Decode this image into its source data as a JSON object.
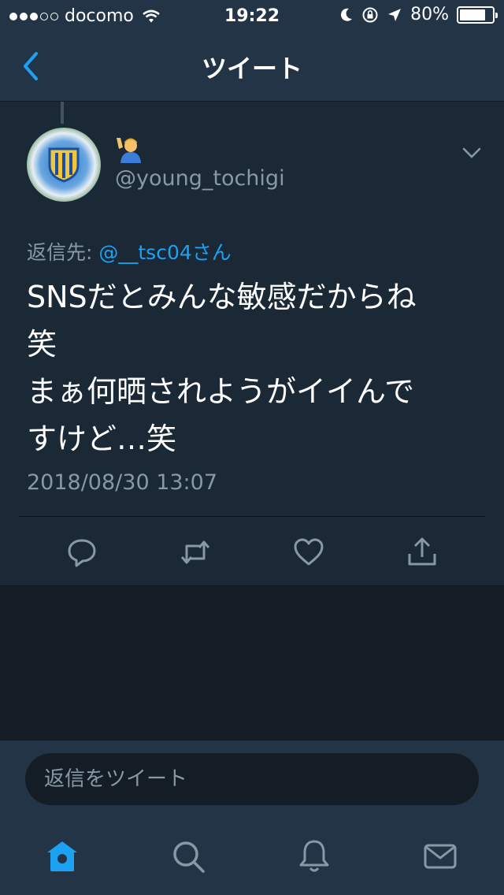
{
  "status_bar": {
    "carrier": "docomo",
    "time": "19:22",
    "battery": "80%",
    "battery_level": 0.8
  },
  "nav": {
    "title": "ツイート",
    "back_icon": "chevron-left-icon"
  },
  "tweet": {
    "display_name_emoji": "🙋‍♂️",
    "handle": "@young_tochigi",
    "reply_to_label": "返信先: ",
    "reply_to_mention": "@__tsc04さん",
    "text": "SNSだとみんな敏感だからね\n笑\nまぁ何晒されようがイイんで\nすけど…笑",
    "timestamp": "2018/08/30 13:07",
    "actions": [
      "reply-icon",
      "retweet-icon",
      "like-icon",
      "share-icon"
    ]
  },
  "composer": {
    "placeholder": "返信をツイート"
  },
  "tab_bar": {
    "items": [
      "home-icon",
      "search-icon",
      "notifications-icon",
      "messages-icon"
    ],
    "active": "home-icon"
  },
  "colors": {
    "accent": "#1da1f2",
    "background": "#141d26",
    "card": "#1b2836",
    "bar": "#243447",
    "secondary_text": "#8899a6"
  }
}
